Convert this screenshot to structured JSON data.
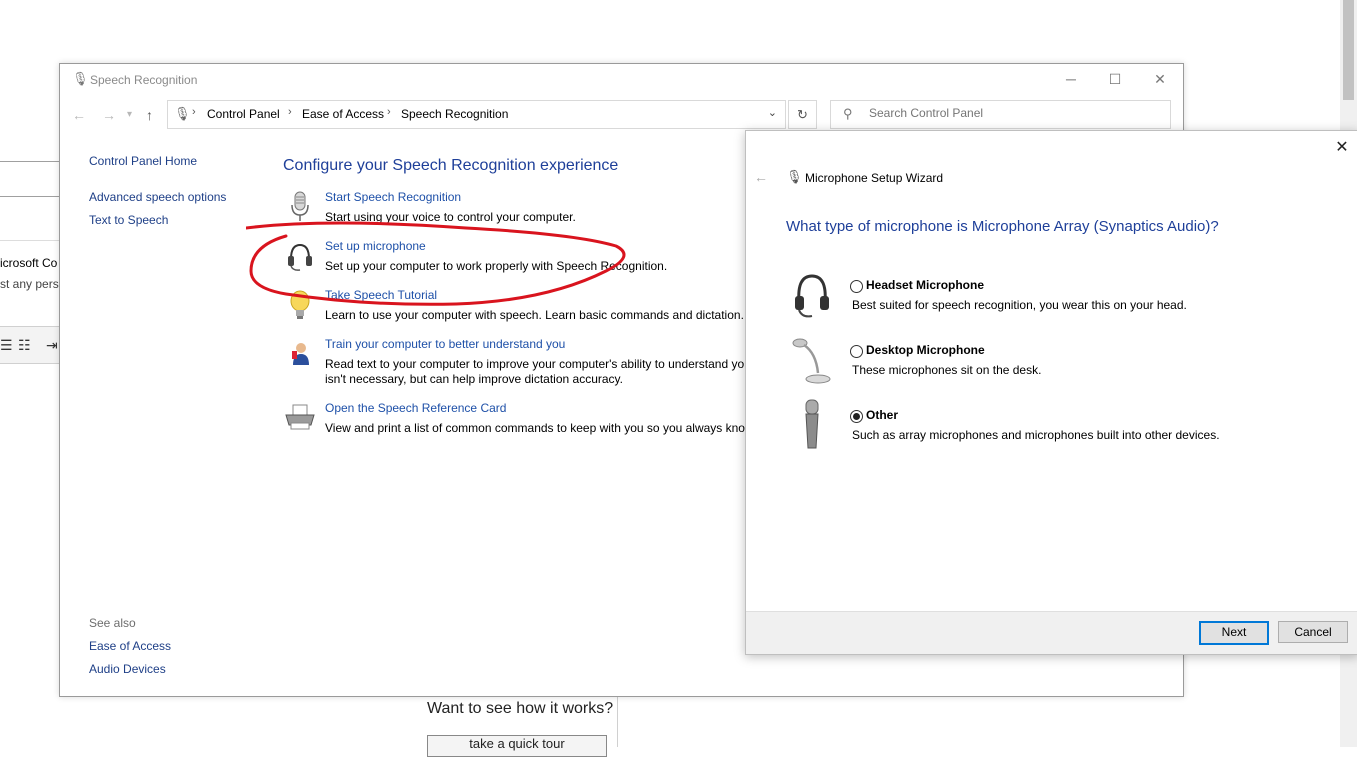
{
  "background_app": {
    "partial_text_1": "icrosoft Co",
    "partial_text_2": "st any pers",
    "tour_prompt": "Want to see how it works?",
    "tour_button": "take a quick tour"
  },
  "window": {
    "title": "Speech Recognition",
    "controls": {
      "minimize": "─",
      "maximize": "☐",
      "close": "✕"
    }
  },
  "address_bar": {
    "breadcrumbs": [
      "Control Panel",
      "Ease of Access",
      "Speech Recognition"
    ],
    "search_placeholder": "Search Control Panel"
  },
  "sidebar": {
    "home": "Control Panel Home",
    "links": [
      "Advanced speech options",
      "Text to Speech"
    ],
    "see_also_label": "See also",
    "see_also_links": [
      "Ease of Access",
      "Audio Devices"
    ]
  },
  "main": {
    "heading": "Configure your Speech Recognition experience",
    "tasks": [
      {
        "icon": "microphone-icon",
        "link": "Start Speech Recognition",
        "desc": "Start using your voice to control your computer."
      },
      {
        "icon": "headset-icon",
        "link": "Set up microphone",
        "desc": "Set up your computer to work properly with Speech Recognition."
      },
      {
        "icon": "lightbulb-icon",
        "link": "Take Speech Tutorial",
        "desc": "Learn to use your computer with speech.  Learn basic commands and dictation."
      },
      {
        "icon": "user-train-icon",
        "link": "Train your computer to better understand you",
        "desc": "Read text to your computer to improve your computer's ability to understand yo",
        "desc2": "isn't necessary, but can help improve dictation accuracy."
      },
      {
        "icon": "printer-icon",
        "link": "Open the Speech Reference Card",
        "desc": "View and print a list of common commands to keep with you so you always kno"
      }
    ],
    "annotation_color": "#d9141e"
  },
  "wizard": {
    "title": "Microphone Setup Wizard",
    "question": "What type of microphone is Microphone Array (Synaptics Audio)?",
    "options": [
      {
        "label": "Headset Microphone",
        "desc": "Best suited for speech recognition, you wear this on your head.",
        "selected": false
      },
      {
        "label": "Desktop Microphone",
        "desc": "These microphones sit on the desk.",
        "selected": false
      },
      {
        "label": "Other",
        "desc": "Such as array microphones and microphones built into other devices.",
        "selected": true
      }
    ],
    "next_button": "Next",
    "cancel_button": "Cancel",
    "accent_color": "#0078d7"
  }
}
